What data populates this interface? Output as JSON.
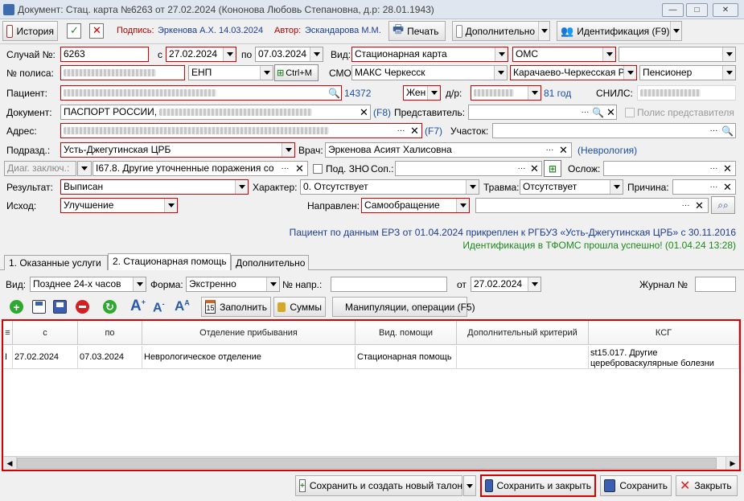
{
  "window": {
    "title": "Документ: Стац. карта №6263 от 27.02.2024 (Кононова Любовь Степановна, д.р: 28.01.1943)"
  },
  "toolbar": {
    "history": "История",
    "signature_label": "Подпись:",
    "signature_value": "Эркенова А.Х. 14.03.2024",
    "author_label": "Автор:",
    "author_value": "Эскандарова М.М.",
    "print": "Печать",
    "additional": "Дополнительно",
    "identification": "Идентификация (F9)"
  },
  "form": {
    "case_no_label": "Случай №:",
    "case_no": "6263",
    "from_label": "с",
    "date_from": "27.02.2024",
    "to_label": "по",
    "date_to": "07.03.2024",
    "kind_label": "Вид:",
    "kind": "Стационарная карта",
    "payment": "ОМС",
    "policy_label": "№ полиса:",
    "policy_type": "ЕНП",
    "ctrl_m": "Ctrl+M",
    "smo_label": "СМО:",
    "smo": "МАКС Черкесск",
    "region": "Карачаево-Черкесская Р",
    "category": "Пенсионер",
    "patient_label": "Пациент:",
    "patient_id": "14372",
    "sex": "Жен",
    "dob_label": "д/р:",
    "age": "81 год",
    "snils_label": "СНИЛС:",
    "document_label": "Документ:",
    "document": "ПАСПОРТ РОССИИ,",
    "f8": "(F8)",
    "representative_label": "Представитель:",
    "policy_representative": "Полис представителя",
    "address_label": "Адрес:",
    "f7": "(F7)",
    "district_label": "Участок:",
    "division_label": "Подразд.:",
    "division": "Усть-Джегутинская ЦРБ",
    "doctor_label": "Врач:",
    "doctor": "Эркенова Асият Халисовна",
    "specialty": "(Неврология)",
    "diag_label": "Диаг. заключ.:",
    "diagnosis": "I67.8. Другие уточненные поражения со",
    "zno_label": "Под. ЗНО",
    "concomitant_label": "Соп.:",
    "complication_label": "Ослож:",
    "result_label": "Результат:",
    "result": "Выписан",
    "character_label": "Характер:",
    "character": "0. Отсутствует",
    "trauma_label": "Травма:",
    "trauma": "Отсутствует",
    "reason_label": "Причина:",
    "outcome_label": "Исход:",
    "outcome": "Улучшение",
    "directed_label": "Направлен:",
    "directed": "Самообращение"
  },
  "info": {
    "attachment": "Пациент по данным ЕРЗ от 01.04.2024 прикреплен к РГБУЗ «Усть-Джегутинская ЦРБ» с 30.11.2016",
    "tfoms": "Идентификация в ТФОМС прошла успешно! (01.04.24 13:28)"
  },
  "tabs": [
    {
      "label": "1. Оказанные услуги"
    },
    {
      "label": "2. Стационарная помощь"
    },
    {
      "label": "Дополнительно"
    }
  ],
  "filters": {
    "kind_label": "Вид:",
    "kind": "Позднее 24-х часов",
    "form_label": "Форма:",
    "form": "Экстренно",
    "direction_no_label": "№ напр.:",
    "from_label": "от",
    "from_date": "27.02.2024",
    "journal_label": "Журнал №"
  },
  "grid_toolbar": {
    "fill": "Заполнить",
    "sums": "Суммы",
    "manipulations": "Манипуляции, операции (F5)"
  },
  "grid": {
    "columns": [
      "с",
      "по",
      "Отделение прибывания",
      "Вид. помощи",
      "Дополнительный критерий",
      "КСГ"
    ],
    "rows": [
      [
        "27.02.2024",
        "07.03.2024",
        "Неврологическое отделение",
        "Стационарная помощь",
        "",
        "st15.017. Другие цереброваскулярные болезни"
      ]
    ]
  },
  "bottom": {
    "save_new": "Сохранить и создать новый талон",
    "save_close": "Сохранить и закрыть",
    "save": "Сохранить",
    "close": "Закрыть"
  }
}
